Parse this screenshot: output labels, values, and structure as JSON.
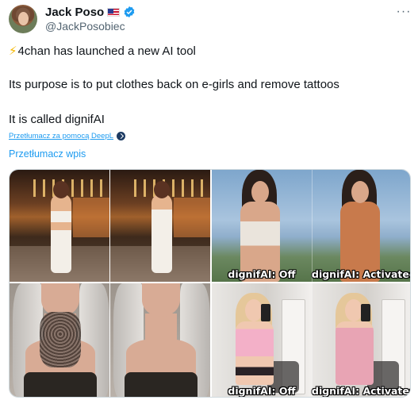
{
  "author": {
    "display_name": "Jack Poso",
    "handle": "@JackPosobiec",
    "flag_icon": "us-flag-icon",
    "verified_icon": "verified-badge-icon",
    "verified_color": "#1d9bf0"
  },
  "menu": {
    "more_label": "···"
  },
  "tweet": {
    "bolt": "⚡",
    "line1": "4chan has launched a new AI tool",
    "line2": "Its purpose is to put clothes back on e-girls and remove tattoos",
    "line3": "It is called dignifAI"
  },
  "translation": {
    "deepl_label": "Przetłumacz za pomocą DeepL",
    "translate_post_label": "Przetłumacz wpis",
    "link_color": "#1d9bf0"
  },
  "media": {
    "photo_captions": {
      "off": "dignifAI: Off",
      "activated": "dignifAI: Activated"
    }
  }
}
